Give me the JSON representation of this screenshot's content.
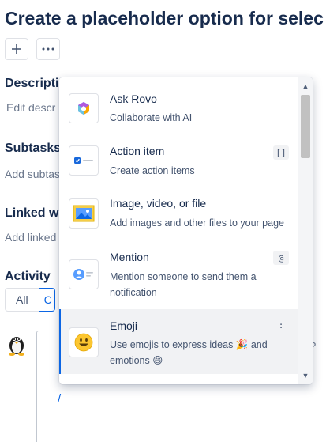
{
  "page": {
    "title": "Create a placeholder option for selec"
  },
  "toolbar": {
    "add_icon": "plus-icon",
    "more_icon": "ellipsis-icon"
  },
  "sections": {
    "description": {
      "heading": "Descripti",
      "placeholder": "Edit descr"
    },
    "subtasks": {
      "heading": "Subtasks",
      "placeholder": "Add subtas"
    },
    "linked": {
      "heading": "Linked w",
      "placeholder": "Add linked"
    },
    "activity": {
      "heading": "Activity",
      "tabs": [
        "All",
        "C"
      ]
    }
  },
  "editor": {
    "cursor_text": "/"
  },
  "menu": {
    "items": [
      {
        "icon": "rovo-icon",
        "title": "Ask Rovo",
        "description": "Collaborate with AI",
        "shortcut": ""
      },
      {
        "icon": "action-item-icon",
        "title": "Action item",
        "description": "Create action items",
        "shortcut": "[]"
      },
      {
        "icon": "image-icon",
        "title": "Image, video, or file",
        "description": "Add images and other files to your page",
        "shortcut": ""
      },
      {
        "icon": "mention-icon",
        "title": "Mention",
        "description": "Mention someone to send them a notification",
        "shortcut": "@"
      },
      {
        "icon": "emoji-icon",
        "title": "Emoji",
        "description": "Use emojis to express ideas 🎉 and emotions 😄",
        "shortcut": ":"
      }
    ],
    "selected_index": 4
  },
  "colors": {
    "accent": "#0c66e4",
    "text": "#172b4d",
    "selected_bg": "#f1f2f4"
  }
}
